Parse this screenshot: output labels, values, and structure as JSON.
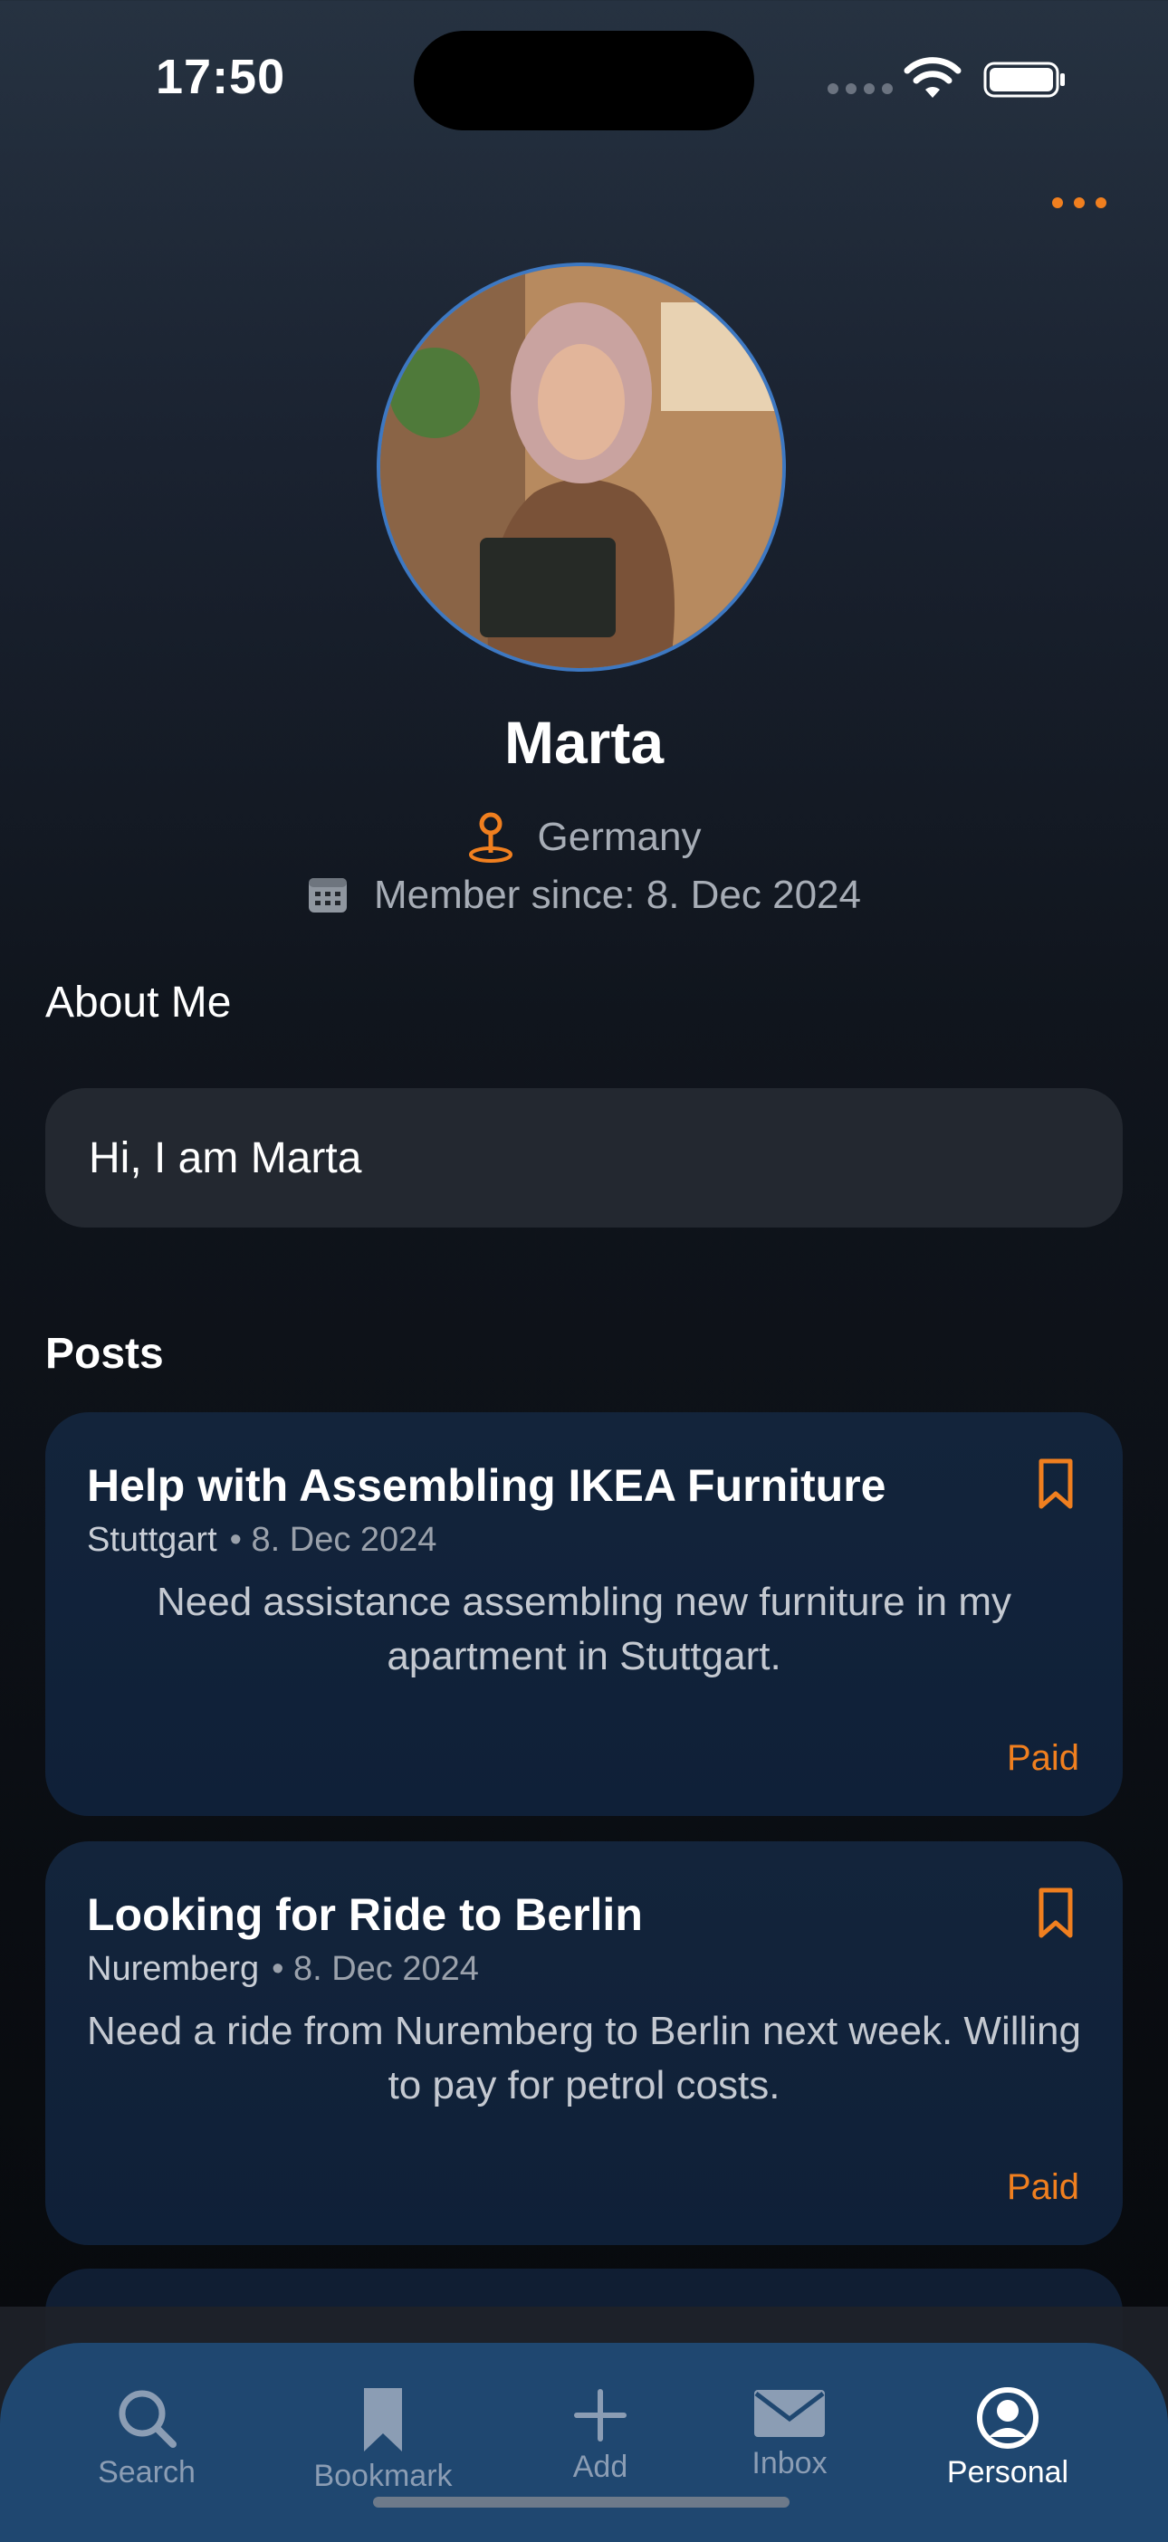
{
  "status_bar": {
    "time": "17:50"
  },
  "colors": {
    "accent": "#f07f1f",
    "tabbar": "#1f4770",
    "card": "#13243b"
  },
  "profile": {
    "name": "Marta",
    "location": "Germany",
    "member_since": "Member since: 8. Dec 2024"
  },
  "about": {
    "title": "About Me",
    "text": "Hi, I am Marta"
  },
  "posts": {
    "title": "Posts",
    "items": [
      {
        "title": "Help with Assembling IKEA Furniture",
        "city": "Stuttgart",
        "date": "• 8. Dec 2024",
        "description": "Need assistance assembling new furniture in my apartment in Stuttgart.",
        "price": "Paid"
      },
      {
        "title": "Looking for Ride to Berlin",
        "city": "Nuremberg",
        "date": "• 8. Dec 2024",
        "description": "Need a ride from Nuremberg to Berlin next week. Willing to pay for petrol costs.",
        "price": "Paid"
      }
    ]
  },
  "tabs": [
    {
      "label": "Search",
      "icon": "search-icon"
    },
    {
      "label": "Bookmark",
      "icon": "bookmark-icon"
    },
    {
      "label": "Add",
      "icon": "plus-icon"
    },
    {
      "label": "Inbox",
      "icon": "envelope-icon"
    },
    {
      "label": "Personal",
      "icon": "person-circle-icon",
      "active": true
    }
  ]
}
